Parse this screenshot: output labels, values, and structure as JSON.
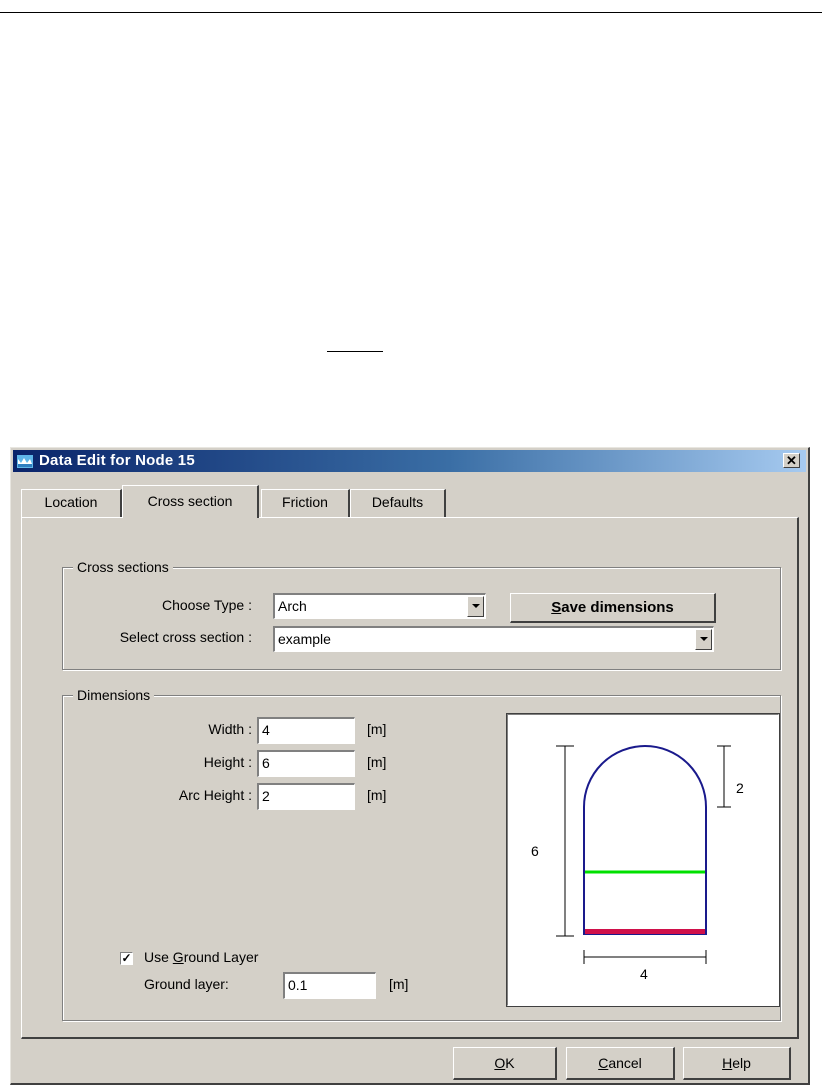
{
  "window": {
    "title": "Data Edit for Node 15"
  },
  "tabs": [
    {
      "label": "Location"
    },
    {
      "label": "Cross section"
    },
    {
      "label": "Friction"
    },
    {
      "label": "Defaults"
    }
  ],
  "cross_sections": {
    "group_title": "Cross sections",
    "choose_type_label": "Choose Type :",
    "choose_type_value": "Arch",
    "select_label": "Select cross section :",
    "select_value": "example",
    "save_button": {
      "pre": "",
      "accel": "S",
      "post": "ave dimensions"
    }
  },
  "dimensions": {
    "group_title": "Dimensions",
    "width_label": "Width :",
    "width_value": "4",
    "height_label": "Height :",
    "height_value": "6",
    "arc_height_label": "Arc Height :",
    "arc_height_value": "2",
    "unit": "[m]"
  },
  "ground_layer": {
    "checkbox_checked": true,
    "checkbox_label": {
      "pre": "Use ",
      "accel": "G",
      "post": "round Layer"
    },
    "label": "Ground layer:",
    "value": "0.1",
    "unit": "[m]"
  },
  "preview": {
    "height_value": "6",
    "arc_value": "2",
    "width_value": "4",
    "colors": {
      "outline": "#1a1a8c",
      "water": "#00e000",
      "ground": "#d0104a"
    }
  },
  "buttons": {
    "ok": {
      "pre": "",
      "accel": "O",
      "post": "K"
    },
    "cancel": {
      "pre": "",
      "accel": "C",
      "post": "ancel"
    },
    "help": {
      "pre": "",
      "accel": "H",
      "post": "elp"
    }
  }
}
